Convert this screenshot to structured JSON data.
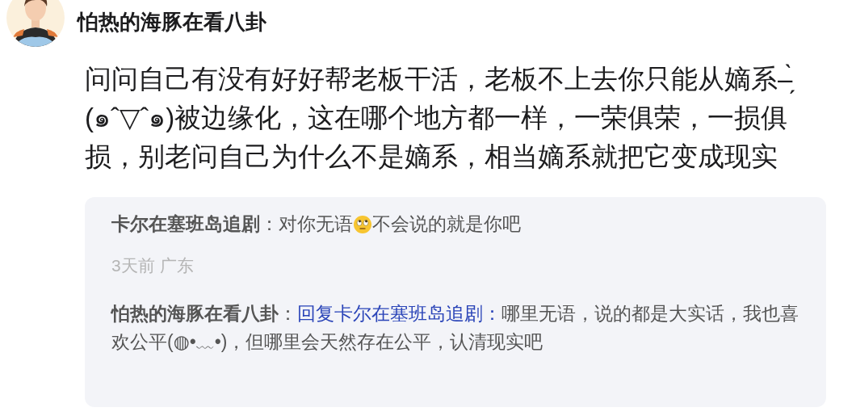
{
  "post": {
    "author": "怕热的海豚在看八卦",
    "body": "问问自己有没有好好帮老板干活，老板不上去你只能从嫡系–̗̀(๑ˆ▽ˆ๑)被边缘化，这在哪个地方都一样，一荣俱荣，一损俱损，别老问自己为什么不是嫡系，相当嫡系就把它变成现实"
  },
  "replies": {
    "comment": {
      "author": "卡尔在塞班岛追剧",
      "text_before_emoji": "：对你无语",
      "text_after_emoji": "不会说的就是你吧",
      "meta": "3天前 广东"
    },
    "reply": {
      "author": "怕热的海豚在看八卦",
      "separator": "：",
      "reply_to": "回复卡尔在塞班岛追剧：",
      "text": "哪里无语，说的都是大实话，我也喜欢公平(◍•﹏•)，但哪里会天然存在公平，认清现实吧"
    }
  }
}
